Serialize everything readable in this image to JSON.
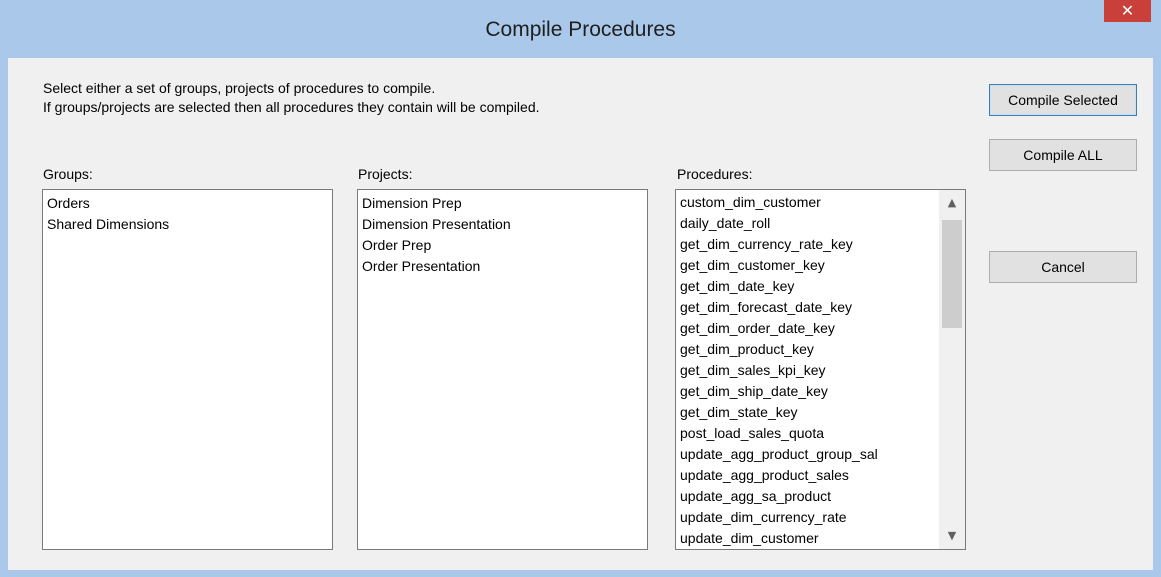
{
  "window": {
    "title": "Compile Procedures",
    "close_glyph": "✕"
  },
  "instructions": {
    "line1": "Select either a set of groups, projects of procedures to compile.",
    "line2": "If groups/projects are selected then all procedures they contain will be compiled."
  },
  "groups": {
    "label": "Groups:",
    "items": [
      "Orders",
      "Shared Dimensions"
    ]
  },
  "projects": {
    "label": "Projects:",
    "items": [
      "Dimension Prep",
      "Dimension Presentation",
      "Order Prep",
      "Order Presentation"
    ]
  },
  "procedures": {
    "label": "Procedures:",
    "items": [
      "custom_dim_customer",
      "daily_date_roll",
      "get_dim_currency_rate_key",
      "get_dim_customer_key",
      "get_dim_date_key",
      "get_dim_forecast_date_key",
      "get_dim_order_date_key",
      "get_dim_product_key",
      "get_dim_sales_kpi_key",
      "get_dim_ship_date_key",
      "get_dim_state_key",
      "post_load_sales_quota",
      "update_agg_product_group_sal",
      "update_agg_product_sales",
      "update_agg_sa_product",
      "update_dim_currency_rate",
      "update_dim_customer"
    ],
    "scroll_up_glyph": "▲",
    "scroll_down_glyph": "▼"
  },
  "buttons": {
    "compile_selected": "Compile Selected",
    "compile_all": "Compile ALL",
    "cancel": "Cancel"
  },
  "colors": {
    "title_bar": "#a9c8ea",
    "close_button": "#c9403a",
    "dialog_bg": "#f0f0f0"
  }
}
